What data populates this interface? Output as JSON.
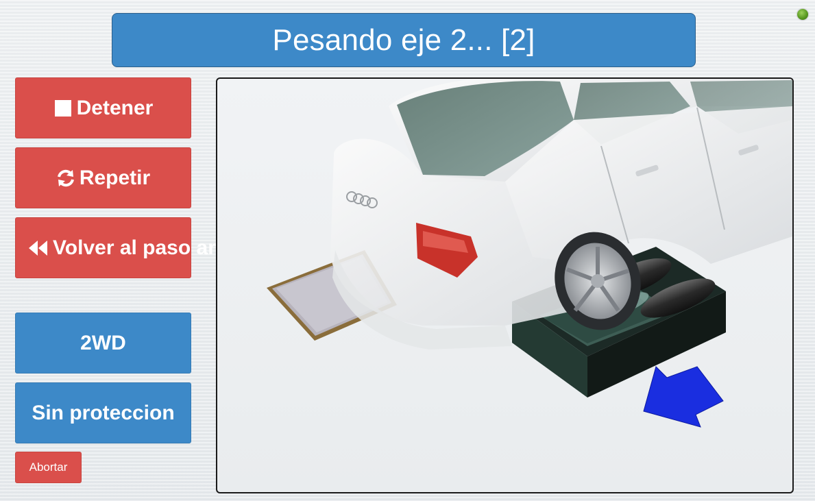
{
  "header": {
    "title": "Pesando eje 2... [2]"
  },
  "status": {
    "indicator_color": "#5a9a22",
    "indicator_icon": "status-led-icon"
  },
  "sidebar": {
    "stop_label": "Detener",
    "stop_icon": "stop-square-icon",
    "repeat_label": "Repetir",
    "repeat_icon": "refresh-icon",
    "back_label": "Volver al paso an",
    "back_icon": "fast-backward-icon",
    "drive_mode_label": "2WD",
    "protection_label": "Sin proteccion",
    "abort_label": "Abortar"
  },
  "scene": {
    "description_icon": "car-on-weighing-plates-illustration",
    "arrow_color": "#1a2ee0"
  },
  "colors": {
    "primary_blue": "#3d89c8",
    "danger_red": "#da4f4b",
    "text_white": "#ffffff"
  }
}
